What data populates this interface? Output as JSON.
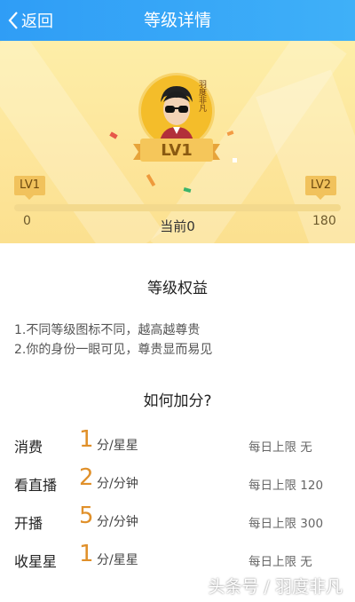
{
  "header": {
    "back_label": "返回",
    "title": "等级详情"
  },
  "hero": {
    "level_badge": "LV1",
    "avatar_text": "羽度非凡",
    "start_level": "LV1",
    "next_level": "LV2",
    "progress_min": "0",
    "progress_max": "180",
    "current_label": "当前0",
    "progress_value": 0
  },
  "benefits": {
    "title": "等级权益",
    "rules": [
      "1.不同等级图标不同，越高越尊贵",
      "2.你的身份一眼可见，尊贵显而易见"
    ]
  },
  "scoring": {
    "title": "如何加分?",
    "rows": [
      {
        "name": "消费",
        "points": "1",
        "unit": "分/星星",
        "limit": "每日上限 无"
      },
      {
        "name": "看直播",
        "points": "2",
        "unit": "分/分钟",
        "limit": "每日上限 120"
      },
      {
        "name": "开播",
        "points": "5",
        "unit": "分/分钟",
        "limit": "每日上限 300"
      },
      {
        "name": "收星星",
        "points": "1",
        "unit": "分/星星",
        "limit": "每日上限 无"
      }
    ]
  },
  "watermark": "头条号 / 羽度非凡",
  "colors": {
    "header": "#3fa7f7",
    "hero": "#fde59a",
    "accent": "#e0902a"
  }
}
